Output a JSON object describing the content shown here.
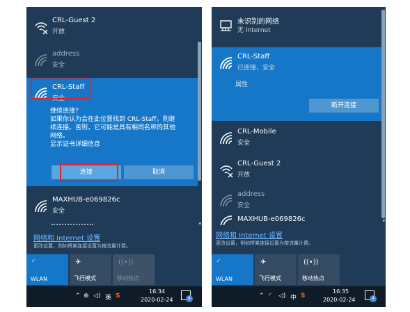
{
  "colors": {
    "panel_bg": "#1f3b57",
    "selected_bg": "#1677c8",
    "link": "#6fb7ff",
    "annotation": "#e0232b"
  },
  "left": {
    "networks": [
      {
        "name": "CRL-Guest 2",
        "status": "开放",
        "icon": "wifi-open-icon"
      },
      {
        "name": "address",
        "status": "安全",
        "icon": "wifi-weak-icon"
      },
      {
        "name": "CRL-Staff",
        "status": "安全",
        "icon": "wifi-icon"
      },
      {
        "name": "MAXHUB-e069826c",
        "status": "安全",
        "icon": "wifi-icon"
      }
    ],
    "prompt": {
      "title": "继续连接?",
      "body1": "如果你认为会在此位置找到 CRL-Staff，则继",
      "body2": "续连接。否则，它可能是具有相同名称的其他",
      "body3": "网络。",
      "details": "显示证书详细信息"
    },
    "connect_label": "连接",
    "cancel_label": "取消",
    "settings_link": "网络和 Internet 设置",
    "settings_hint": "更改设置，例如将某连接设置为按流量计费。",
    "tiles": [
      {
        "label": "WLAN",
        "icon": "wifi-tile-icon"
      },
      {
        "label": "飞行模式",
        "icon": "airplane-icon"
      },
      {
        "label": "移动热点",
        "icon": "hotspot-icon"
      }
    ],
    "taskbar": {
      "ime": "英",
      "time": "16:34",
      "date": "2020-02-24",
      "notif_count": "4"
    }
  },
  "right": {
    "unknown_network": {
      "name": "未识别的网络",
      "status": "无 Internet"
    },
    "connected": {
      "name": "CRL-Staff",
      "status": "已连接，安全",
      "properties": "属性",
      "disconnect": "断开连接"
    },
    "networks": [
      {
        "name": "CRL-Mobile",
        "status": "安全",
        "icon": "wifi-icon"
      },
      {
        "name": "CRL-Guest 2",
        "status": "开放",
        "icon": "wifi-open-icon"
      },
      {
        "name": "address",
        "status": "安全",
        "icon": "wifi-weak-icon"
      },
      {
        "name": "MAXHUB-e069826c",
        "status": "",
        "icon": "wifi-icon"
      }
    ],
    "settings_link": "网络和 Internet 设置",
    "settings_hint": "更改设置，例如将某连接设置为按流量计费。",
    "tiles": [
      {
        "label": "WLAN",
        "icon": "wifi-tile-icon"
      },
      {
        "label": "飞行模式",
        "icon": "airplane-icon"
      },
      {
        "label": "移动热点",
        "icon": "hotspot-icon"
      }
    ],
    "taskbar": {
      "ime": "中",
      "time": "16:35",
      "date": "2020-02-24",
      "notif_count": "4"
    }
  }
}
